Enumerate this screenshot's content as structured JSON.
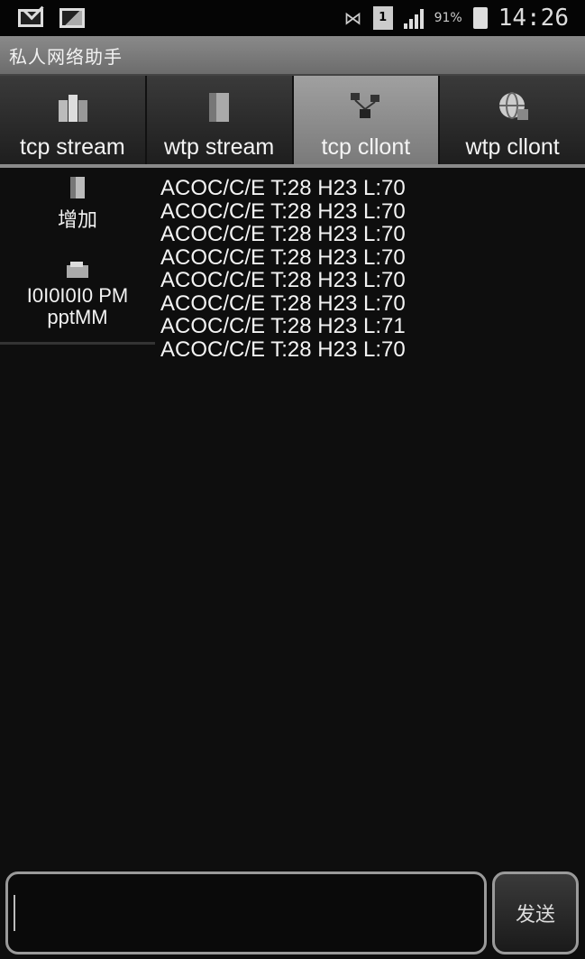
{
  "status_bar": {
    "icons": [
      "mail-icon",
      "picture-icon",
      "network-icon",
      "sim-icon",
      "signal-icon",
      "battery-icon"
    ],
    "sim_number": "1",
    "battery": "91%",
    "time": "14:26"
  },
  "title_bar": {
    "title": "私人网络助手"
  },
  "tabs": [
    {
      "label": "tcp stream",
      "icon": "server-icon",
      "active": false
    },
    {
      "label": "wtp stream",
      "icon": "book-icon",
      "active": false
    },
    {
      "label": "tcp cllont",
      "icon": "network-nodes-icon",
      "active": true
    },
    {
      "label": "wtp cllont",
      "icon": "globe-icon",
      "active": false
    }
  ],
  "side_list": {
    "add_item": {
      "label": "增加",
      "icon": "device-icon"
    },
    "connection_item": {
      "line1": "I0I0I0I0 PM",
      "line2": "pptMM",
      "icon": "computer-icon"
    }
  },
  "messages": [
    "ACOC/C/E T:28 H23 L:70",
    "ACOC/C/E T:28 H23 L:70",
    "ACOC/C/E T:28 H23 L:70",
    "ACOC/C/E T:28 H23 L:70",
    "ACOC/C/E T:28 H23 L:70",
    "ACOC/C/E T:28 H23 L:70",
    "ACOC/C/E T:28 H23 L:71",
    "ACOC/C/E T:28 H23 L:70"
  ],
  "bottom_bar": {
    "input_value": "",
    "send_label": "发送"
  },
  "colors": {
    "background": "#0e0e0e",
    "title_bar": "#7a7a7a",
    "active_tab": "#8c8c8c",
    "text": "#f4f4f4"
  }
}
